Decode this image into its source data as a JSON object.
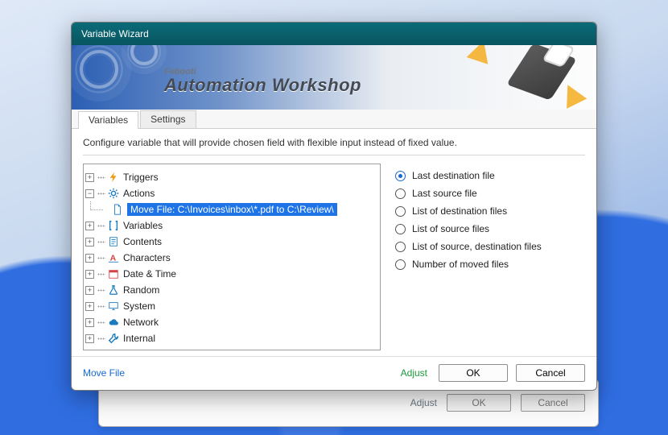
{
  "window": {
    "title": "Variable Wizard"
  },
  "banner": {
    "subbrand": "Febooti",
    "brand": "Automation Workshop"
  },
  "tabs": {
    "variables": "Variables",
    "settings": "Settings"
  },
  "description": "Configure variable that will provide chosen field with flexible input instead of fixed value.",
  "tree": {
    "triggers": "Triggers",
    "actions": "Actions",
    "actions_item": "Move File: C:\\Invoices\\inbox\\*.pdf to C:\\Review\\",
    "variables": "Variables",
    "contents": "Contents",
    "characters": "Characters",
    "datetime": "Date & Time",
    "random": "Random",
    "system": "System",
    "network": "Network",
    "internal": "Internal"
  },
  "radios": {
    "r0": "Last destination file",
    "r1": "Last source file",
    "r2": "List of destination files",
    "r3": "List of source files",
    "r4": "List of source, destination files",
    "r5": "Number of moved files"
  },
  "footer": {
    "left": "Move File",
    "adjust": "Adjust",
    "ok": "OK",
    "cancel": "Cancel"
  },
  "shadow": {
    "adjust": "Adjust",
    "ok": "OK",
    "cancel": "Cancel"
  }
}
